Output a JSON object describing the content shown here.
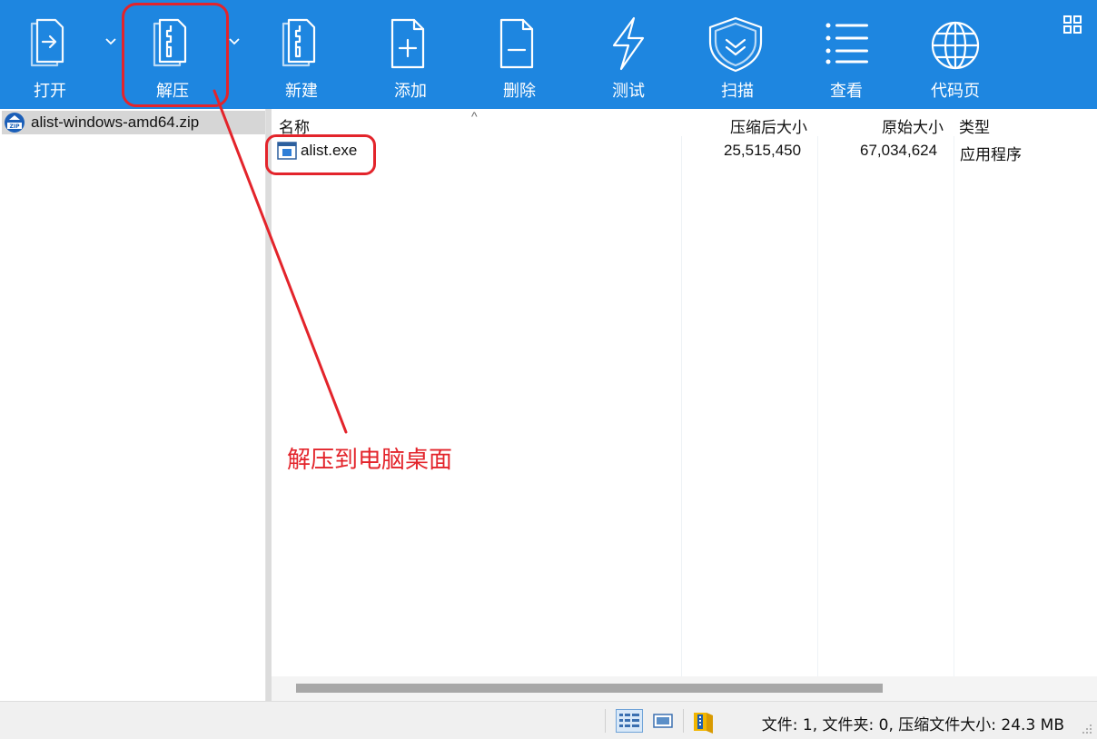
{
  "toolbar": {
    "items": [
      {
        "label": "打开",
        "icon": "open-icon"
      },
      {
        "label": "解压",
        "icon": "extract-icon"
      },
      {
        "label": "新建",
        "icon": "new-archive-icon"
      },
      {
        "label": "添加",
        "icon": "add-file-icon"
      },
      {
        "label": "删除",
        "icon": "delete-file-icon"
      },
      {
        "label": "测试",
        "icon": "test-icon"
      },
      {
        "label": "扫描",
        "icon": "scan-shield-icon"
      },
      {
        "label": "查看",
        "icon": "view-list-icon"
      },
      {
        "label": "代码页",
        "icon": "globe-icon"
      }
    ],
    "bg_color": "#1e86e0"
  },
  "tree": {
    "selected_archive": "alist-windows-amd64.zip",
    "archive_icon": "zip-archive-icon"
  },
  "list": {
    "columns": [
      "名称",
      "压缩后大小",
      "原始大小",
      "类型"
    ],
    "sort_indicator": "^",
    "rows": [
      {
        "name": "alist.exe",
        "packed": "25,515,450",
        "original": "67,034,624",
        "type": "应用程序",
        "icon": "exe-file-icon"
      }
    ]
  },
  "status": {
    "text": "文件: 1, 文件夹: 0, 压缩文件大小: 24.3 MB"
  },
  "annotation": {
    "text": "解压到电脑桌面",
    "color": "#e3242b"
  }
}
